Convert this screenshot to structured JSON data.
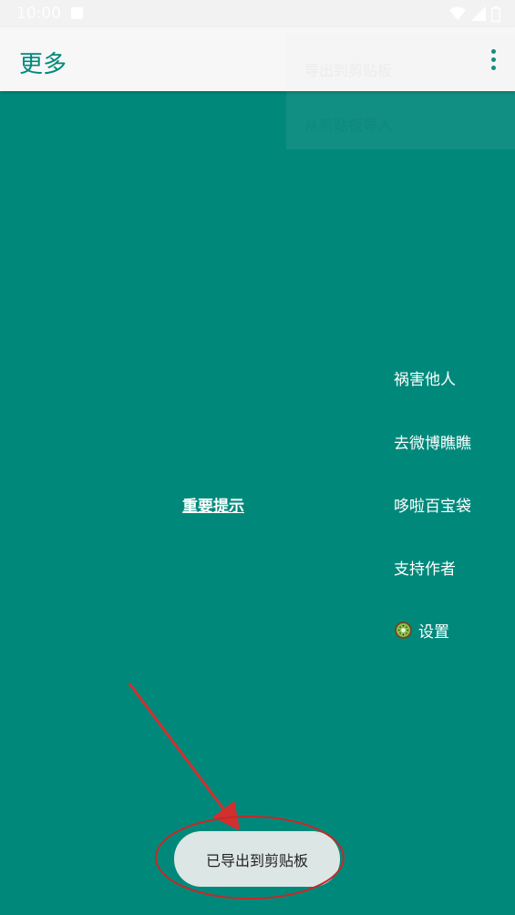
{
  "status_bar": {
    "time": "10:00",
    "icons": [
      "notification-icon",
      "wifi-icon",
      "signal-icon",
      "battery-icon"
    ]
  },
  "app_bar": {
    "title": "更多",
    "overflow_icon": "more-vert-icon"
  },
  "popup_menu": {
    "items": [
      "导出到剪贴板",
      "从剪贴板导入"
    ]
  },
  "main": {
    "important_link": "重要提示",
    "menu_items": [
      {
        "label": "祸害他人"
      },
      {
        "label": "去微博瞧瞧"
      },
      {
        "label": "哆啦百宝袋"
      },
      {
        "label": "支持作者"
      },
      {
        "label": "设置",
        "icon": "kiwi-icon"
      }
    ]
  },
  "toast": {
    "message": "已导出到剪贴板"
  },
  "colors": {
    "primary": "#00897B",
    "app_bar": "#F7F7F7",
    "toast_bg": "#DCE6E4",
    "annotation": "#D32F2F"
  }
}
